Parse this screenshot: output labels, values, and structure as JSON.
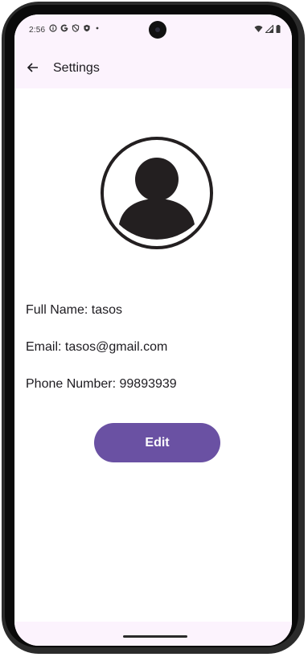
{
  "status_bar": {
    "time": "2:56",
    "left_icons": [
      "info-icon",
      "google-icon",
      "shield-icon",
      "shield-filled-icon",
      "dot-icon"
    ],
    "right_icons": [
      "wifi-icon",
      "signal-icon",
      "battery-icon"
    ]
  },
  "app_bar": {
    "back_icon": "arrow-left-icon",
    "title": "Settings"
  },
  "profile": {
    "avatar_icon": "account-circle-icon",
    "full_name_line": "Full Name: tasos",
    "email_line": "Email: tasos@gmail.com",
    "phone_line": "Phone Number: 99893939"
  },
  "actions": {
    "edit_label": "Edit"
  },
  "colors": {
    "accent": "#6a51a3",
    "bar_background": "#fcf3fd",
    "text": "#1d1b20"
  }
}
